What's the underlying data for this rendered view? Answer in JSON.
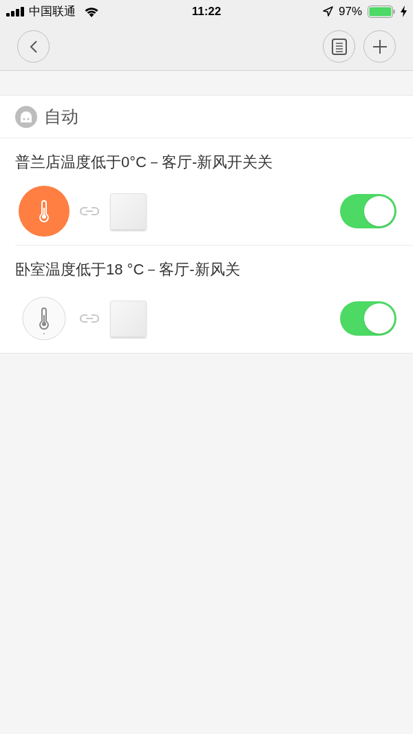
{
  "status_bar": {
    "carrier": "中国联通",
    "time": "11:22",
    "battery": "97%"
  },
  "section": {
    "title": "自动"
  },
  "rules": [
    {
      "title": "普兰店温度低于0°C－客厅-新风开关关",
      "kind": "weather",
      "on": true
    },
    {
      "title": "卧室温度低于18 °C－客厅-新风关",
      "kind": "sensor",
      "on": true
    }
  ]
}
